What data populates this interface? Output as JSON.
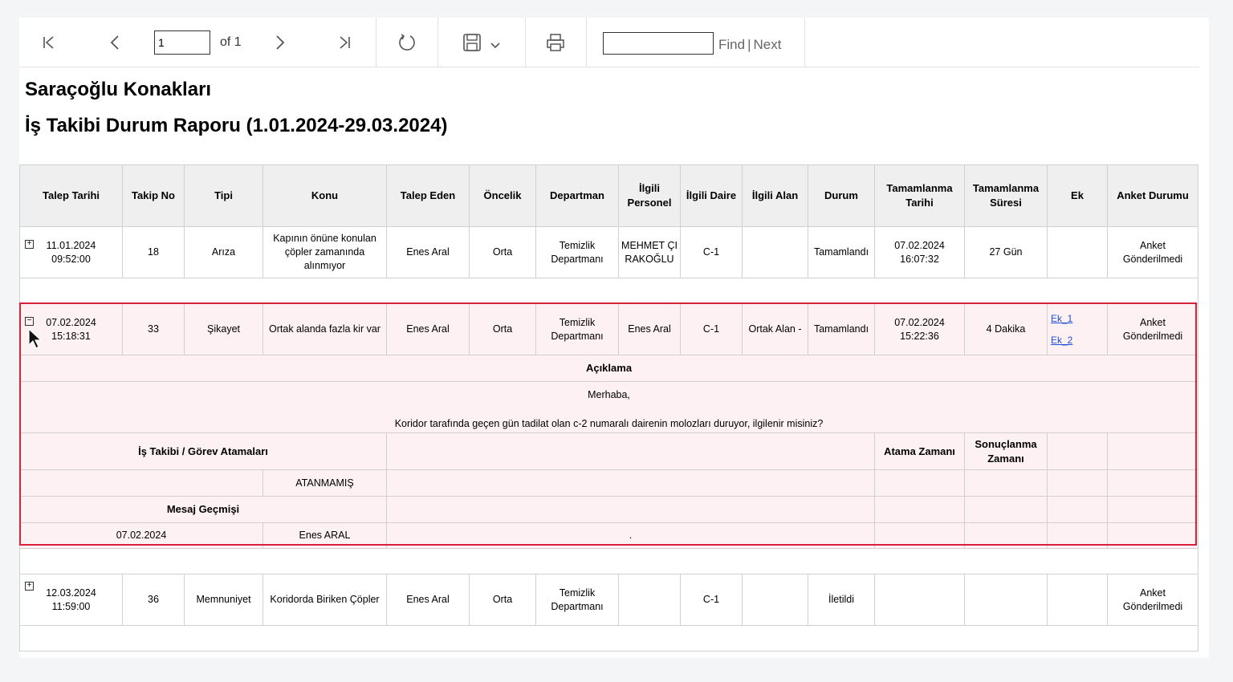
{
  "toolbar": {
    "page_value": "1",
    "page_of": "of 1",
    "find_label": "Find",
    "find_sep": "|",
    "next_label": "Next",
    "icons": [
      "first-page-icon",
      "prev-page-icon",
      "next-page-icon",
      "last-page-icon",
      "refresh-icon",
      "save-icon",
      "chevron-down-icon",
      "print-icon"
    ]
  },
  "report": {
    "title": "Saraçoğlu Konakları",
    "subtitle": "İş Takibi Durum Raporu (1.01.2024-29.03.2024)"
  },
  "table": {
    "headers": [
      "Talep Tarihi",
      "Takip No",
      "Tipi",
      "Konu",
      "Talep Eden",
      "Öncelik",
      "Departman",
      "İlgili Personel",
      "İlgili Daire",
      "İlgili Alan",
      "Durum",
      "Tamamlanma Tarihi",
      "Tamamlanma Süresi",
      "Ek",
      "Anket Durumu"
    ],
    "rows": [
      {
        "date": "11.01.2024",
        "time": "09:52:00",
        "no": "18",
        "tipi": "Arıza",
        "konu": "Kapının önüne konulan çöpler zamanında alınmıyor",
        "talep_eden": "Enes Aral",
        "oncelik": "Orta",
        "departman": "Temizlik Departmanı",
        "personel": "MEHMET ÇIRAKOĞLU",
        "daire": "C-1",
        "alan": "",
        "durum": "Tamamlandı",
        "t_tarih": "07.02.2024",
        "t_saat": "16:07:32",
        "sure": "27 Gün",
        "ek1": "",
        "ek2": "",
        "anket": "Anket Gönderilmedi"
      },
      {
        "date": "07.02.2024",
        "time": "15:18:31",
        "no": "33",
        "tipi": "Şikayet",
        "konu": "Ortak alanda fazla kir var",
        "talep_eden": "Enes Aral",
        "oncelik": "Orta",
        "departman": "Temizlik Departmanı",
        "personel": "Enes Aral",
        "daire": "C-1",
        "alan": "Ortak Alan -",
        "durum": "Tamamlandı",
        "t_tarih": "07.02.2024",
        "t_saat": "15:22:36",
        "sure": "4 Dakika",
        "ek1": "Ek_1",
        "ek2": "Ek_2",
        "anket": "Anket Gönderilmedi"
      },
      {
        "date": "12.03.2024",
        "time": "11:59:00",
        "no": "36",
        "tipi": "Memnuniyet",
        "konu": "Koridorda Biriken Çöpler",
        "talep_eden": "Enes Aral",
        "oncelik": "Orta",
        "departman": "Temizlik Departmanı",
        "personel": "",
        "daire": "C-1",
        "alan": "",
        "durum": "İletildi",
        "t_tarih": "",
        "t_saat": "",
        "sure": "",
        "ek1": "",
        "ek2": "",
        "anket": "Anket Gönderilmedi"
      }
    ],
    "detail": {
      "aciklama_label": "Açıklama",
      "line1": "Merhaba,",
      "line2": "Koridor tarafında geçen gün tadilat olan c-2 numaralı dairenin molozları duruyor, ilgilenir misiniz?",
      "gorev_label": "İş Takibi / Görev Atamaları",
      "atama_label": "Atama Zamanı",
      "sonuc_label": "Sonuçlanma Zamanı",
      "atanmamis": "ATANMAMIŞ",
      "mesaj_label": "Mesaj Geçmişi",
      "mesaj_date": "07.02.2024",
      "mesaj_user": "Enes ARAL",
      "mesaj_text": "."
    }
  },
  "colors": {
    "highlight_border": "#d9213a",
    "highlight_bg": "#fdf1f3",
    "header_bg": "#efefef",
    "link": "#1d4ed8"
  }
}
